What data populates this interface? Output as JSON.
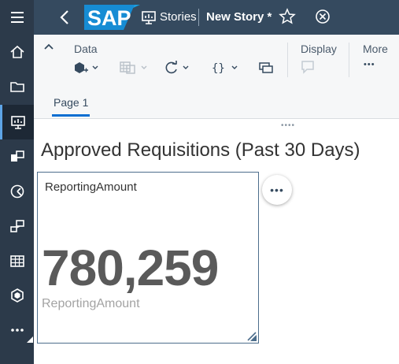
{
  "shell": {
    "brand": "SAP",
    "section": "Stories",
    "story_name": "New Story *"
  },
  "rail": {
    "items": [
      {
        "icon": "menu-icon"
      },
      {
        "icon": "home-icon"
      },
      {
        "icon": "folder-icon"
      },
      {
        "icon": "stories-icon"
      },
      {
        "icon": "analytic-app-icon"
      },
      {
        "icon": "digital-boardroom-icon"
      },
      {
        "icon": "data-modeler-icon"
      },
      {
        "icon": "table-icon"
      },
      {
        "icon": "cube-icon"
      },
      {
        "icon": "more-icon"
      }
    ]
  },
  "toolbar": {
    "data_label": "Data",
    "display_label": "Display",
    "more_label": "More",
    "more_glyph": "•••"
  },
  "tabs": [
    {
      "label": "Page 1"
    }
  ],
  "canvas": {
    "title": "Approved Requisitions (Past 30 Days)",
    "tile": {
      "header": "ReportingAmount",
      "value": "780,259",
      "subtitle": "ReportingAmount",
      "more_glyph": "•••"
    },
    "grip": "••••"
  },
  "colors": {
    "rail": "#2c3a4a",
    "shell": "#354a5f",
    "toolbar": "#f6f7f8",
    "accent": "#0a6ed1"
  }
}
